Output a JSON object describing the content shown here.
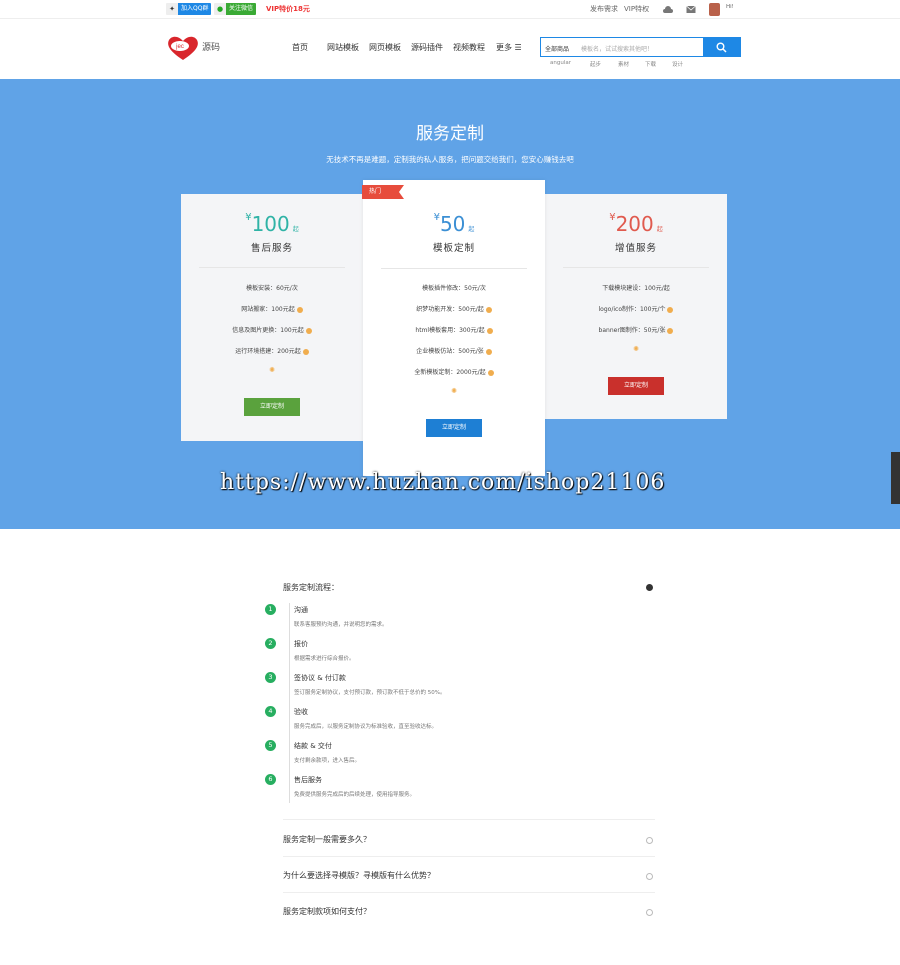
{
  "topbar": {
    "qq_group_label": "加入QQ群",
    "wechat_label": "关注微信",
    "vip_promo": "VIP特价18元",
    "right_links": [
      "发布需求",
      "VIP特权"
    ],
    "user_name": "Hi!"
  },
  "header": {
    "logo_text": "jec",
    "site_name": "源码",
    "nav": [
      "首页",
      "网站模板",
      "网页模板",
      "源码插件",
      "视频教程",
      "更多 ☰"
    ],
    "search": {
      "category": "全部商品",
      "placeholder": "模板名，试试搜索其他吧！"
    },
    "hot_keywords": [
      "angular",
      "起步",
      "素材",
      "下载",
      "设计"
    ]
  },
  "banner": {
    "title": "服务定制",
    "subtitle": "无技术不再是难题，定制我的私人服务，把问题交给我们，您安心赚钱去吧"
  },
  "pricing": {
    "currency_symbol": "¥",
    "start_suffix": "起",
    "popular_ribbon": "热门",
    "plans": [
      {
        "price": "100",
        "name": "售后服务",
        "color": "#2fb3a6",
        "features": [
          "模板安装：60元/次",
          "网站搬家：100元起",
          "信息及图片更换：100元起",
          "运行环境搭建：200元起"
        ],
        "button": "立即定制",
        "button_color": "#5aa23d"
      },
      {
        "price": "50",
        "name": "模板定制",
        "color": "#3b8fd4",
        "features": [
          "模板插件修改：50元/次",
          "织梦功能开发：500元/起",
          "html模板套用：300元/起",
          "企业模板仿站：500元/张",
          "全新模板定制：2000元/起"
        ],
        "button": "立即定制",
        "button_color": "#1e7fd4"
      },
      {
        "price": "200",
        "name": "增值服务",
        "color": "#e05a4e",
        "features": [
          "下载模块建设：100元/起",
          "logo/ico制作：100元/个",
          "banner图制作：50元/张"
        ],
        "button": "立即定制",
        "button_color": "#c9302c"
      }
    ]
  },
  "watermark": "https://www.huzhan.com/ishop21106",
  "faq": {
    "process_title": "服务定制流程：",
    "steps": [
      {
        "num": "1",
        "title": "沟通",
        "desc": "联系客服预约沟通，并说明您的需求。"
      },
      {
        "num": "2",
        "title": "报价",
        "desc": "根据需求进行综合报价。"
      },
      {
        "num": "3",
        "title": "签协议 & 付订款",
        "desc": "签订服务定制协议，支付预订款，预订款不低于总价的 50%。"
      },
      {
        "num": "4",
        "title": "验收",
        "desc": "服务完成后，以服务定制协议为标准验收，直至验收达标。"
      },
      {
        "num": "5",
        "title": "结款 & 交付",
        "desc": "支付剩余款项，进入售后。"
      },
      {
        "num": "6",
        "title": "售后服务",
        "desc": "免费提供服务完成后的后续处理，使用指导服务。"
      }
    ],
    "questions": [
      "服务定制一般需要多久？",
      "为什么要选择寻模版？寻模版有什么优势？",
      "服务定制款项如何支付？"
    ]
  }
}
